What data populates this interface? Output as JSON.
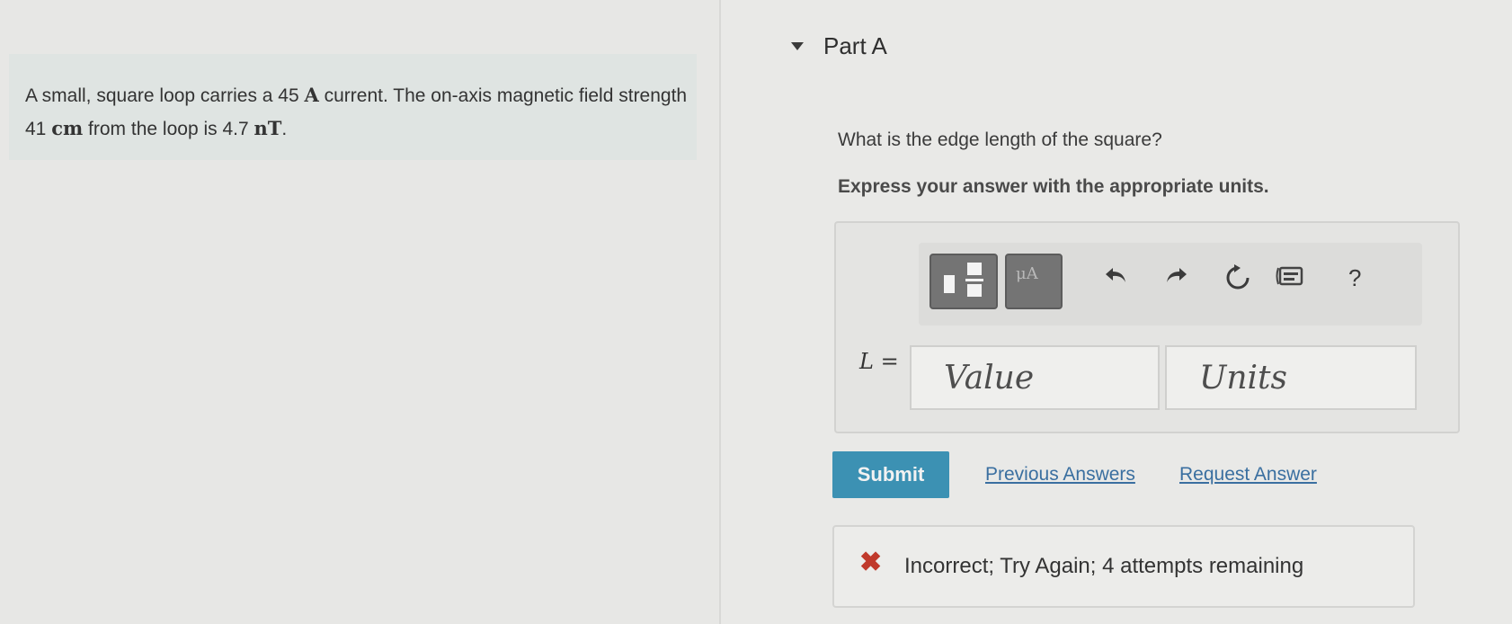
{
  "problem": {
    "text_1": "A small, square loop carries a 45 ",
    "unit_current": "A",
    "text_2": " current. The on-axis magnetic field strength 41 ",
    "unit_distance": "cm",
    "text_3": " from the loop is 4.7 ",
    "unit_field": "nT",
    "text_4": "."
  },
  "part": {
    "title": "Part A"
  },
  "question": "What is the edge length of the square?",
  "instruction": "Express your answer with the appropriate units.",
  "toolbar": {
    "units_label": "μA",
    "help_label": "?"
  },
  "answer": {
    "label": "L =",
    "value_placeholder": "Value",
    "units_placeholder": "Units"
  },
  "actions": {
    "submit": "Submit",
    "previous_answers": "Previous Answers",
    "request_answer": "Request Answer"
  },
  "feedback": {
    "icon": "x-mark",
    "text": "Incorrect; Try Again; 4 attempts remaining"
  },
  "colors": {
    "submit_bg": "#3c91b3",
    "link": "#3a6fa0",
    "error": "#c0392b"
  }
}
